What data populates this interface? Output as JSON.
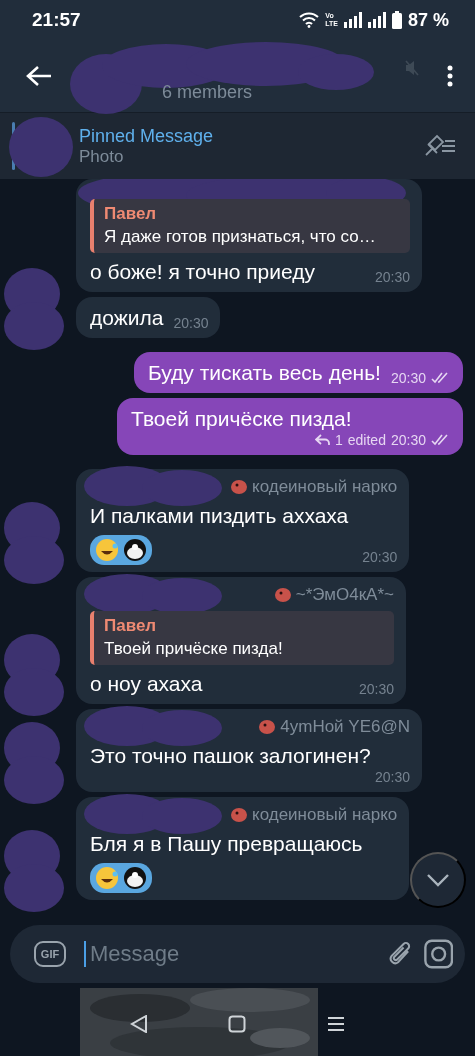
{
  "status_bar": {
    "time": "21:57",
    "network_top": "Vo",
    "network_bottom": "LTE",
    "battery": "87 %"
  },
  "header": {
    "subtitle": "6 members",
    "muted": true
  },
  "pinned": {
    "title": "Pinned Message",
    "text": "Photo"
  },
  "messages": [
    {
      "kind": "incoming",
      "redacted_sender": true,
      "reply": {
        "name": "Павел",
        "text": "Я даже готов признаться, что со…"
      },
      "text": "о боже! я точно приеду",
      "time": "20:30"
    },
    {
      "kind": "incoming",
      "redacted_avatar": true,
      "text": "дожила",
      "time": "20:30"
    },
    {
      "kind": "outgoing",
      "text": "Буду тискать весь день!",
      "time": "20:30",
      "read": true
    },
    {
      "kind": "outgoing",
      "text": "Твоей причёске пизда!",
      "time": "20:30",
      "read": true,
      "replies": "1",
      "edited": "edited"
    },
    {
      "kind": "incoming",
      "redacted_sender": true,
      "redacted_avatar": true,
      "sender": "кодеиновый нарко",
      "text": "И палками пиздить аххаха",
      "reactions": true,
      "time": "20:30"
    },
    {
      "kind": "incoming",
      "redacted_sender": true,
      "redacted_avatar": true,
      "sender": "~*ЭмО4кА*~",
      "reply": {
        "name": "Павел",
        "text": "Твоей причёске пизда!"
      },
      "text": "о ноу ахаха",
      "time": "20:30"
    },
    {
      "kind": "incoming",
      "redacted_sender": true,
      "redacted_avatar": true,
      "sender": "4ymHoй YE6@N",
      "text": "Это точно пашок залогинен?",
      "time": "20:30"
    },
    {
      "kind": "incoming",
      "redacted_sender": true,
      "redacted_avatar": true,
      "sender": "кодеиновый нарко",
      "text": "Бля я в Пашу превращаюсь",
      "reactions": true
    }
  ],
  "composer": {
    "gif": "GIF",
    "placeholder": "Message"
  }
}
